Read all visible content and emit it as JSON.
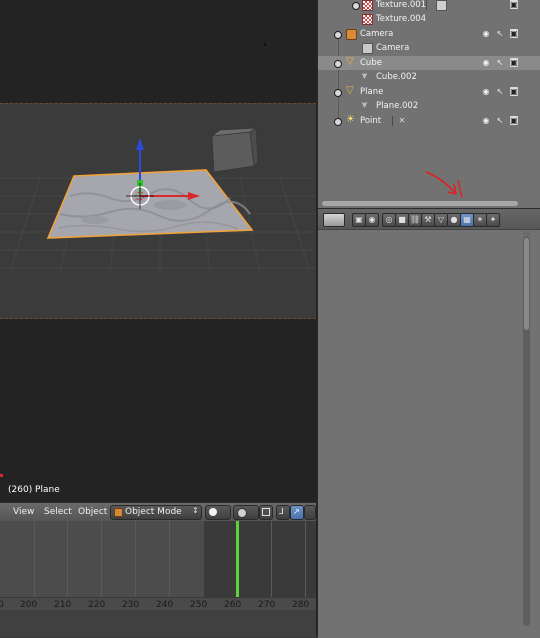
{
  "viewport": {
    "frame_label": "(260) Plane"
  },
  "header": {
    "menus": [
      "View",
      "Select",
      "Object"
    ],
    "mode": "Object Mode",
    "mode_arrows": "↕"
  },
  "timeline": {
    "ticks": [
      "200",
      "210",
      "220",
      "230",
      "240",
      "250",
      "260",
      "270",
      "280"
    ],
    "current_frame": 260
  },
  "outliner": {
    "rows": [
      {
        "label": "Texture.001",
        "kind": "texture"
      },
      {
        "label": "Texture.004",
        "kind": "texture"
      },
      {
        "label": "Camera",
        "kind": "camera-object"
      },
      {
        "label": "Camera",
        "kind": "camera-data"
      },
      {
        "label": "Cube",
        "kind": "mesh-object"
      },
      {
        "label": "Cube.002",
        "kind": "mesh-data"
      },
      {
        "label": "Plane",
        "kind": "mesh-object"
      },
      {
        "label": "Plane.002",
        "kind": "mesh-data"
      },
      {
        "label": "Point",
        "kind": "lamp-object"
      }
    ]
  },
  "properties": {
    "tab_glyphs": [
      "▣",
      "◉",
      "◎",
      "■",
      "⛓",
      "⚒",
      "▽",
      "●",
      "▦",
      "✶",
      "✦"
    ],
    "active_tab_index": 8
  },
  "colors": {
    "selection_orange": "#f0a23c",
    "timeline_cursor": "#5fd23a",
    "annotation_red": "#e02020"
  }
}
